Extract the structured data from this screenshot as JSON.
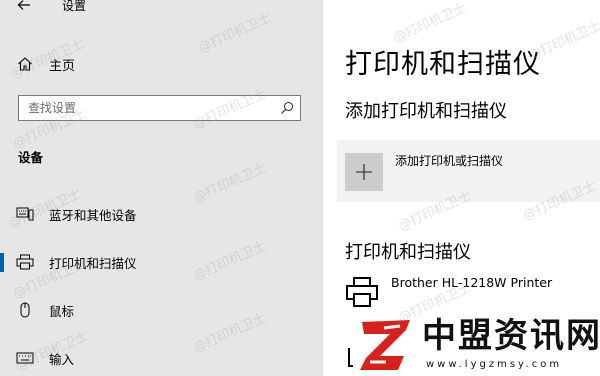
{
  "window": {
    "title": "设置"
  },
  "sidebar": {
    "home_label": "主页",
    "search": {
      "placeholder": "查找设置",
      "value": ""
    },
    "section_heading": "设备",
    "items": [
      {
        "label": "蓝牙和其他设备",
        "icon": "keyboard-icon",
        "selected": false
      },
      {
        "label": "打印机和扫描仪",
        "icon": "printer-icon",
        "selected": true
      },
      {
        "label": "鼠标",
        "icon": "mouse-icon",
        "selected": false
      },
      {
        "label": "输入",
        "icon": "keyboard-input-icon",
        "selected": false
      }
    ]
  },
  "main": {
    "title": "打印机和扫描仪",
    "add_section_heading": "添加打印机和扫描仪",
    "add_button_label": "添加打印机或扫描仪",
    "printers_heading": "打印机和扫描仪",
    "printers": [
      {
        "name": "Brother HL-1218W Printer",
        "icon": "printer-icon"
      }
    ]
  },
  "watermark": {
    "text": "@打印机卫士"
  },
  "logo": {
    "brand": "中盟资讯网",
    "domain": "www.lygzmsy.com",
    "mark_letter": "Z"
  },
  "colors": {
    "sidebar_bg": "#e6e6e6",
    "accent": "#0063b1",
    "add_tile_bg": "#f2f2f2",
    "plus_box_bg": "#cccccc",
    "logo_red": "#d9201a"
  }
}
